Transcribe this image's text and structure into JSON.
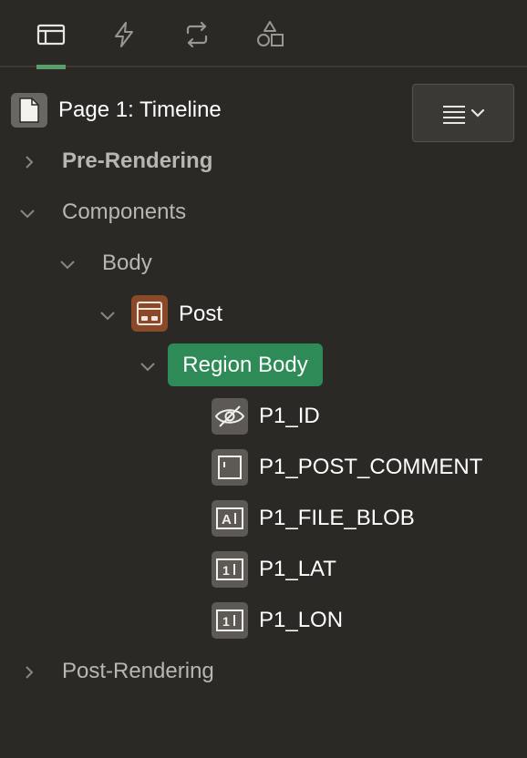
{
  "tabs": [
    {
      "name": "rendering",
      "icon": "layout-icon",
      "active": true
    },
    {
      "name": "dynamic-actions",
      "icon": "lightning-icon",
      "active": false
    },
    {
      "name": "processing",
      "icon": "refresh-icon",
      "active": false
    },
    {
      "name": "shared-components",
      "icon": "shapes-icon",
      "active": false
    }
  ],
  "page": {
    "title": "Page 1: Timeline"
  },
  "tree": {
    "pre_rendering": "Pre-Rendering",
    "components": "Components",
    "body": "Body",
    "post": "Post",
    "region_body": "Region Body",
    "items": [
      "P1_ID",
      "P1_POST_COMMENT",
      "P1_FILE_BLOB",
      "P1_LAT",
      "P1_LON"
    ],
    "post_rendering": "Post-Rendering"
  },
  "colors": {
    "background": "#2b2926",
    "active_tab": "#5a9e6a",
    "region_selected": "#2e8a57",
    "region_icon": "#8a4a2a"
  }
}
